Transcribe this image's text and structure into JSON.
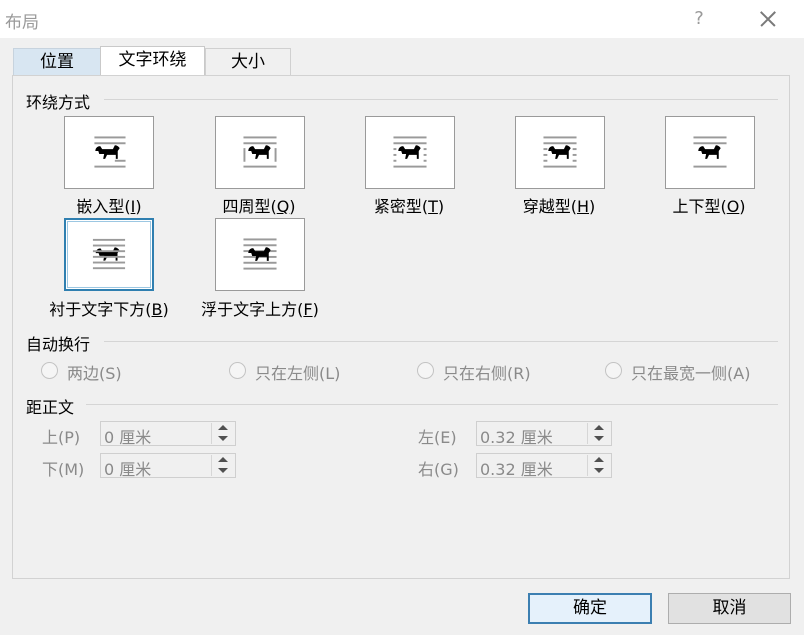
{
  "window": {
    "title": "布局",
    "help_label": "?"
  },
  "tabs": [
    {
      "label": "位置"
    },
    {
      "label": "文字环绕"
    },
    {
      "label": "大小"
    }
  ],
  "wrapping_style": {
    "heading": "环绕方式",
    "options": [
      {
        "text": "嵌入型(",
        "key": "I",
        "end": ")"
      },
      {
        "text": "四周型(",
        "key": "Q",
        "end": ")"
      },
      {
        "text": "紧密型(",
        "key": "T",
        "end": ")"
      },
      {
        "text": "穿越型(",
        "key": "H",
        "end": ")"
      },
      {
        "text": "上下型(",
        "key": "O",
        "end": ")"
      },
      {
        "text": "衬于文字下方(",
        "key": "B",
        "end": ")"
      },
      {
        "text": "浮于文字上方(",
        "key": "F",
        "end": ")"
      }
    ],
    "selected_index": 5
  },
  "wrap_text": {
    "heading": "自动换行",
    "options": [
      "两边(S)",
      "只在左侧(L)",
      "只在右侧(R)",
      "只在最宽一侧(A)"
    ]
  },
  "distance": {
    "heading": "距正文",
    "top": {
      "label": "上(P)",
      "value": "0 厘米"
    },
    "bottom": {
      "label": "下(M)",
      "value": "0 厘米"
    },
    "left": {
      "label": "左(E)",
      "value": "0.32 厘米"
    },
    "right": {
      "label": "右(G)",
      "value": "0.32 厘米"
    }
  },
  "buttons": {
    "ok": "确定",
    "cancel": "取消"
  },
  "colors": {
    "accent": "#2f7fb0",
    "disabled_text": "#8a8a8a"
  }
}
